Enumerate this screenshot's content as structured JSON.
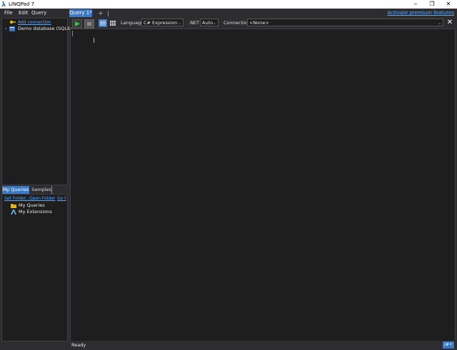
{
  "window": {
    "title": "LINQPad 7",
    "minimize": "‒",
    "restore": "❐",
    "close": "✕"
  },
  "menu": {
    "items": [
      "File",
      "Edit",
      "Query"
    ],
    "premium": "Activate premium features"
  },
  "tabs": {
    "query": "Query 1*",
    "add": "+"
  },
  "connections": {
    "add": "Add connection",
    "demo": "Demo database (SQLite)"
  },
  "left_tabs": {
    "my_queries": "My Queries",
    "samples": "Samples"
  },
  "folder_links": {
    "set_folder": "Set Folder...",
    "open_folder": "Open Folder",
    "go_to": "Go t"
  },
  "my_queries_tree": {
    "folder": "My Queries",
    "extensions": "My Extensions"
  },
  "toolbar": {
    "language_label": "Language",
    "language_value": "C# Expression",
    "net_label": ".NET",
    "net_value": "Auto",
    "connection_label": "Connection",
    "connection_value": "<None>",
    "close": "✕"
  },
  "status": {
    "text": "Ready",
    "badge": "/#+"
  },
  "colors": {
    "accent": "#3b79c6",
    "link": "#5aa9ff",
    "run": "#2ecc40"
  }
}
